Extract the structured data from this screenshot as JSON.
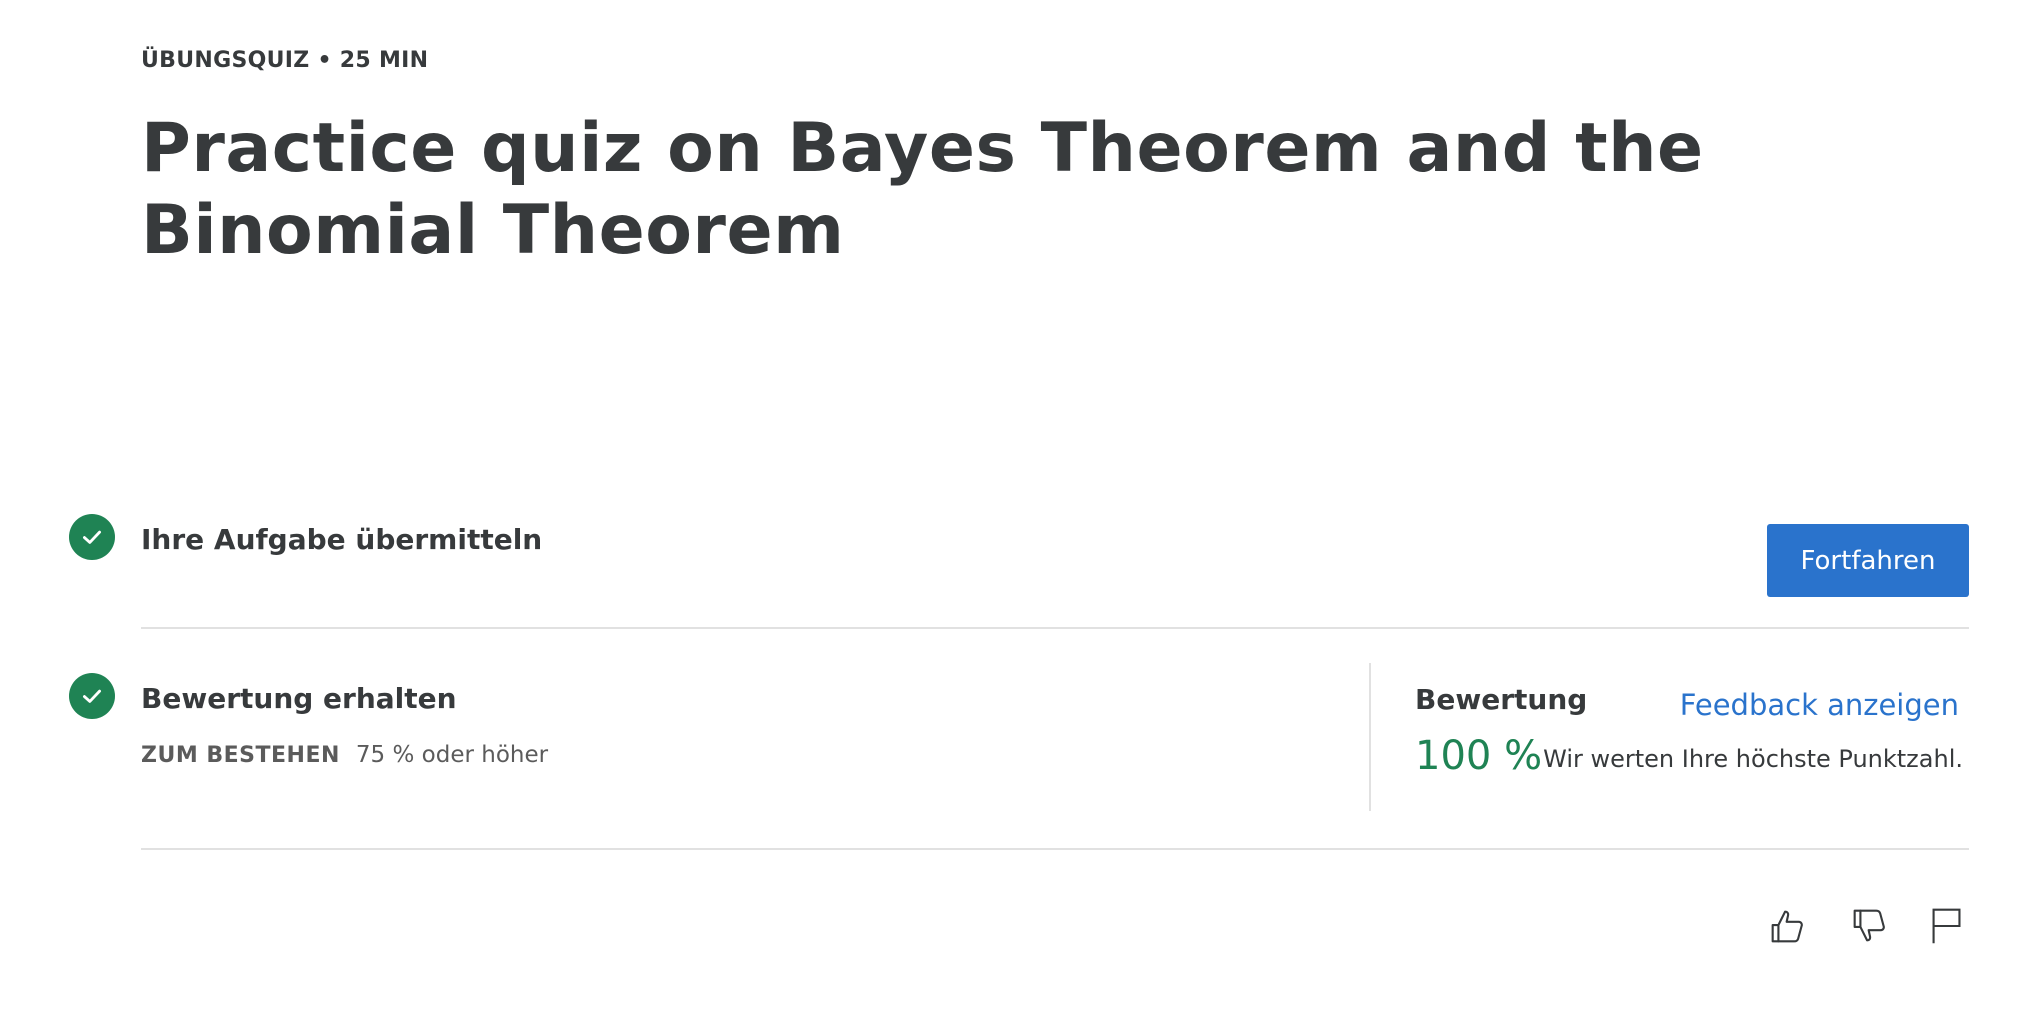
{
  "header": {
    "eyebrow": "ÜBUNGSQUIZ • 25 MIN",
    "title": "Practice quiz on Bayes Theorem and the Binomial Theorem"
  },
  "steps": {
    "submit": {
      "icon": "check-circle-icon",
      "title": "Ihre Aufgabe übermitteln",
      "button_label": "Fortfahren"
    },
    "grade": {
      "icon": "check-circle-icon",
      "title": "Bewertung erhalten",
      "pass_label": "ZUM BESTEHEN",
      "pass_value": "75 % oder höher"
    }
  },
  "grade_panel": {
    "heading": "Bewertung",
    "feedback_link": "Feedback anzeigen",
    "score": "100 %",
    "note": "Wir werten Ihre höchste Punktzahl."
  },
  "actions": {
    "icons": [
      "thumbs-up-icon",
      "thumbs-down-icon",
      "flag-icon"
    ]
  },
  "colors": {
    "accent": "#2a73cc",
    "success": "#1f8354",
    "divider": "#e1e1e1",
    "text": "#373a3c"
  }
}
